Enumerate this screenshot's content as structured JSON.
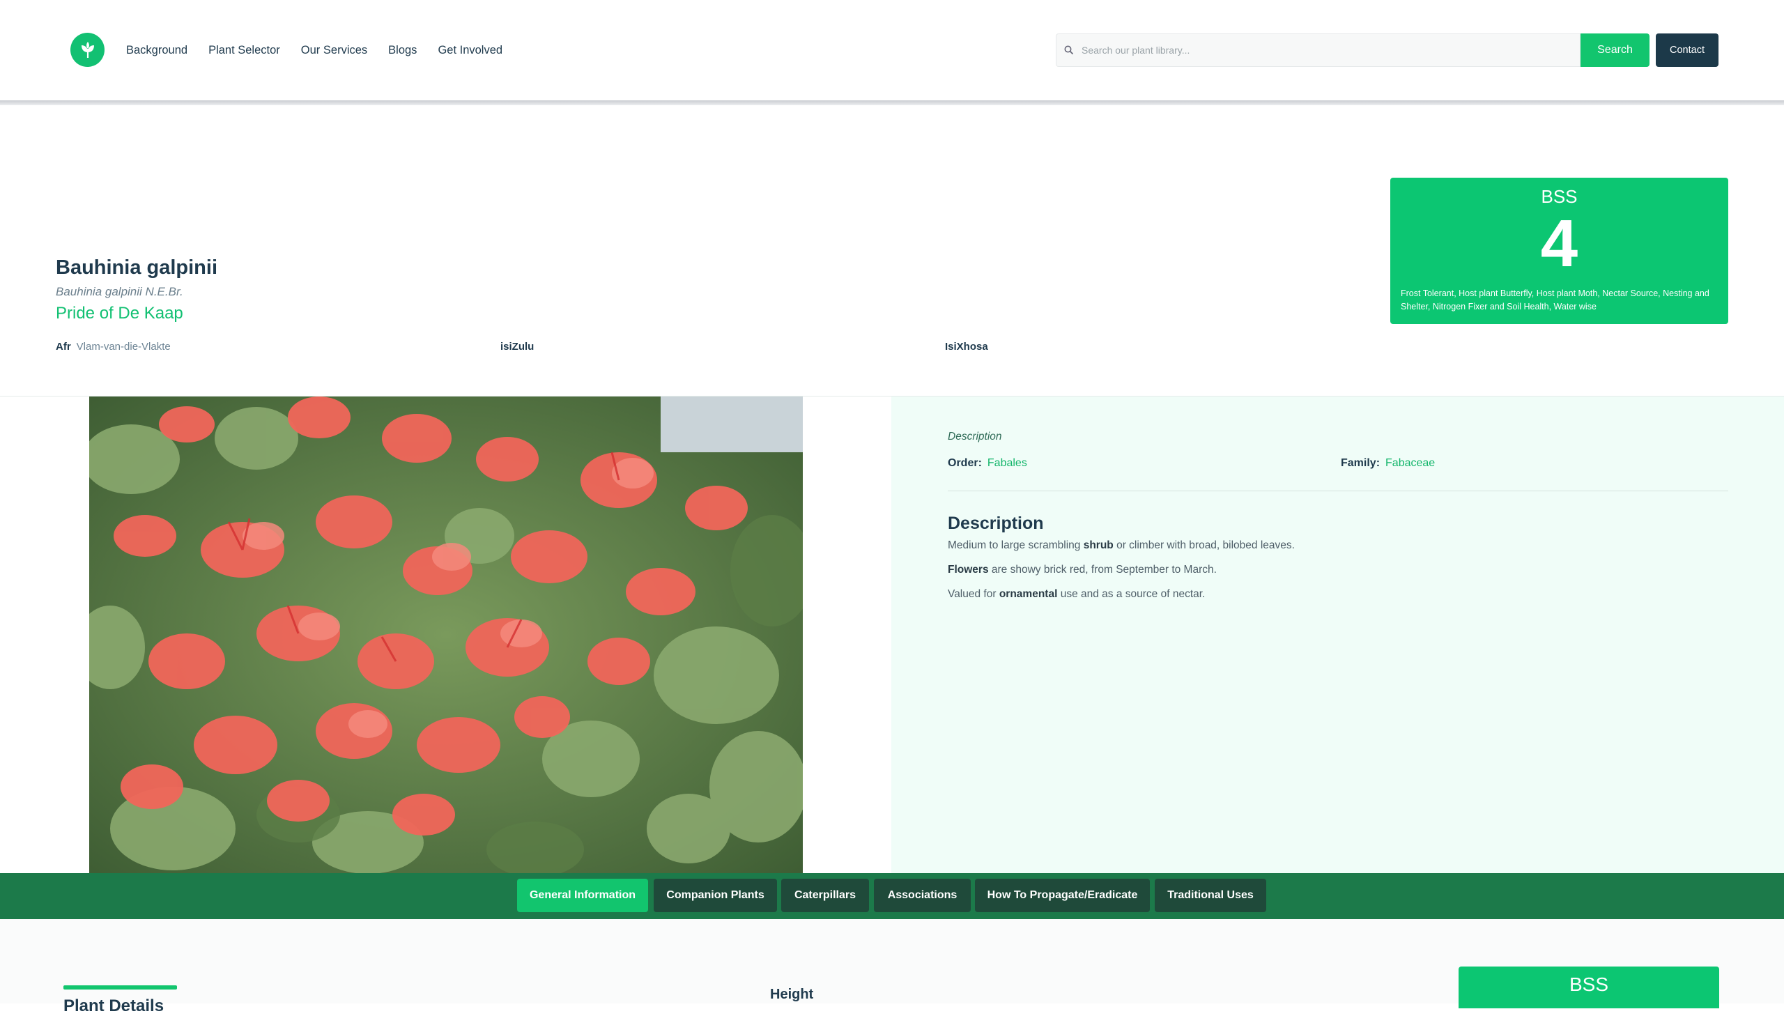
{
  "nav": {
    "items": [
      "Background",
      "Plant Selector",
      "Our Services",
      "Blogs",
      "Get Involved"
    ]
  },
  "search": {
    "placeholder": "Search our plant library...",
    "button_label": "Search"
  },
  "contact_label": "Contact",
  "plant": {
    "scientific_name": "Bauhinia galpinii",
    "authority": "Bauhinia galpinii N.E.Br.",
    "common_name": "Pride of De Kaap",
    "languages": [
      {
        "label": "Afr",
        "value": "Vlam-van-die-Vlakte"
      },
      {
        "label": "isiZulu",
        "value": ""
      },
      {
        "label": "IsiXhosa",
        "value": ""
      }
    ]
  },
  "bss": {
    "title": "BSS",
    "score": "4",
    "description": "Frost Tolerant, Host plant Butterfly, Host plant Moth, Nectar Source, Nesting and Shelter, Nitrogen Fixer and Soil Health, Water wise"
  },
  "info": {
    "description_label": "Description",
    "order_label": "Order:",
    "order_value": "Fabales",
    "family_label": "Family:",
    "family_value": "Fabaceae",
    "heading": "Description",
    "para1": {
      "pre": "Medium to large scrambling ",
      "bold": "shrub",
      "post": " or climber with broad, bilobed leaves."
    },
    "para2": {
      "pre": "",
      "bold": "Flowers",
      "post": " are showy brick red, from September to March."
    },
    "para3": {
      "pre": "Valued for ",
      "bold": "ornamental",
      "post": " use and as a source of nectar."
    }
  },
  "tabs": [
    "General Information",
    "Companion Plants",
    "Caterpillars",
    "Associations",
    "How To Propagate/Eradicate",
    "Traditional Uses"
  ],
  "bottom": {
    "plant_details_heading": "Plant Details",
    "height_label": "Height",
    "bss_title": "BSS"
  },
  "colors": {
    "accent_green": "#12c56e",
    "dark_navy": "#1c3949",
    "tab_bar": "#1c7a4a"
  }
}
